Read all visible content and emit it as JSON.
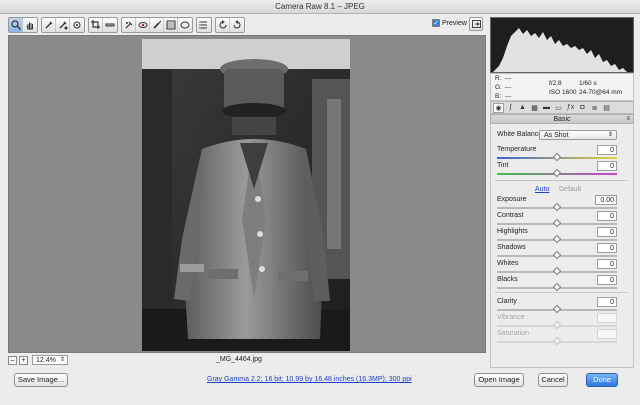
{
  "window": {
    "title": "Camera Raw 8.1  –  JPEG"
  },
  "toolbar": {
    "groups": [
      [
        "zoom-tool",
        "hand-tool"
      ],
      [
        "white-balance-tool",
        "color-sampler-tool",
        "targeted-adjustment-tool"
      ],
      [
        "crop-tool",
        "straighten-tool"
      ],
      [
        "spot-removal-tool",
        "red-eye-tool",
        "adjustment-brush-tool",
        "graduated-filter-tool",
        "radial-filter-tool"
      ],
      [
        "preferences-tool"
      ],
      [
        "rotate-ccw-tool",
        "rotate-cw-tool"
      ]
    ],
    "preview_label": "Preview",
    "preview_checked": true
  },
  "zoom": {
    "value": "12.4%",
    "minus": "–",
    "plus": "+"
  },
  "image": {
    "filename": "_MG_4464.jpg"
  },
  "rgb_info": {
    "r_label": "R:",
    "g_label": "G:",
    "b_label": "B:",
    "r_value": "---",
    "g_value": "---",
    "b_value": "---",
    "aperture": "f/2.8",
    "shutter": "1/60 s",
    "iso": "ISO 1600",
    "lens": "24-70@64 mm"
  },
  "panel": {
    "tabs": [
      "basic-icon",
      "tone-curve-icon",
      "detail-icon",
      "hsl-icon",
      "split-toning-icon",
      "lens-corrections-icon",
      "effects-icon",
      "camera-calibration-icon",
      "presets-icon",
      "snapshots-icon"
    ],
    "title": "Basic",
    "white_balance_label": "White Balance:",
    "white_balance_value": "As Shot",
    "auto_label": "Auto",
    "default_label": "Default",
    "sliders": [
      {
        "key": "temperature",
        "label": "Temperature",
        "value": "0",
        "level": 0.5,
        "style": "temp",
        "disabled": false
      },
      {
        "key": "tint",
        "label": "Tint",
        "value": "0",
        "level": 0.5,
        "style": "tint",
        "disabled": false
      },
      {
        "key": "exposure",
        "label": "Exposure",
        "value": "0.00",
        "level": 0.5,
        "style": "plain",
        "disabled": false
      },
      {
        "key": "contrast",
        "label": "Contrast",
        "value": "0",
        "level": 0.5,
        "style": "plain",
        "disabled": false
      },
      {
        "key": "highlights",
        "label": "Highlights",
        "value": "0",
        "level": 0.5,
        "style": "plain",
        "disabled": false
      },
      {
        "key": "shadows",
        "label": "Shadows",
        "value": "0",
        "level": 0.5,
        "style": "plain",
        "disabled": false
      },
      {
        "key": "whites",
        "label": "Whites",
        "value": "0",
        "level": 0.5,
        "style": "plain",
        "disabled": false
      },
      {
        "key": "blacks",
        "label": "Blacks",
        "value": "0",
        "level": 0.5,
        "style": "plain",
        "disabled": false
      },
      {
        "key": "clarity",
        "label": "Clarity",
        "value": "0",
        "level": 0.5,
        "style": "plain",
        "disabled": false
      },
      {
        "key": "vibrance",
        "label": "Vibrance",
        "value": "",
        "level": 0.5,
        "style": "plain",
        "disabled": true
      },
      {
        "key": "saturation",
        "label": "Saturation",
        "value": "",
        "level": 0.5,
        "style": "plain",
        "disabled": true
      }
    ]
  },
  "bottom": {
    "save_label": "Save Image...",
    "workflow_text": "Gray Gamma 2.2; 16 bit; 10.99 by 16.48 inches (16.3MP); 300 ppi",
    "open_label": "Open Image",
    "cancel_label": "Cancel",
    "done_label": "Done"
  },
  "colors": {
    "accent": "#2d79db",
    "link": "#1a3fd0"
  }
}
